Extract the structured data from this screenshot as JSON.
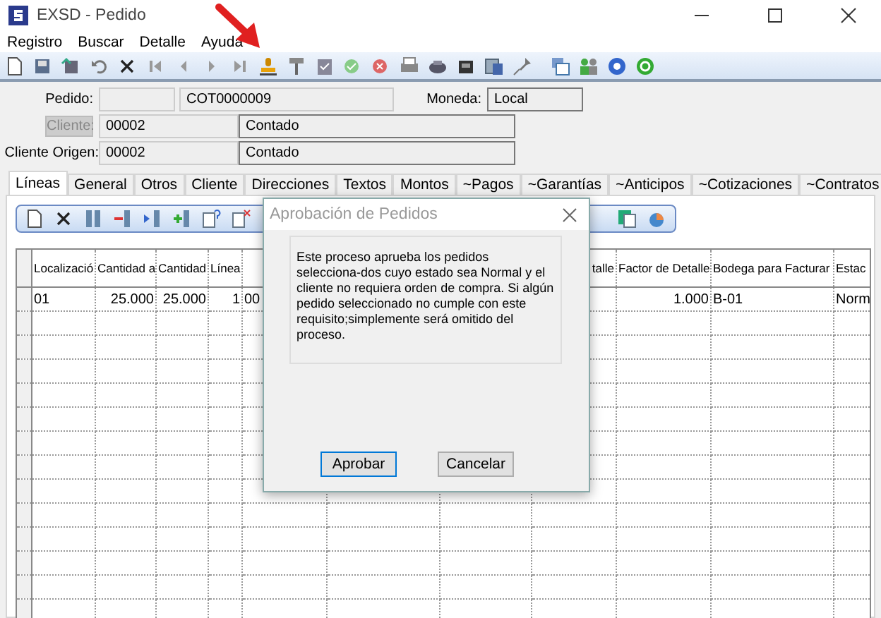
{
  "window": {
    "title": "EXSD - Pedido"
  },
  "menu": [
    "Registro",
    "Buscar",
    "Detalle",
    "Ayuda"
  ],
  "header": {
    "pedido_label": "Pedido:",
    "pedido_value": "COT0000009",
    "moneda_label": "Moneda:",
    "moneda_value": "Local",
    "cliente_button": {
      "label": "Cliente:",
      "disabled": true
    },
    "cliente_code": "00002",
    "cliente_name": "Contado",
    "origen_label": "Cliente Origen:",
    "origen_code": "00002",
    "origen_name": "Contado"
  },
  "tabs": [
    {
      "label": "Líneas",
      "selected": true
    },
    {
      "label": "General",
      "selected": false
    },
    {
      "label": "Otros",
      "selected": false
    },
    {
      "label": "Cliente",
      "selected": false
    },
    {
      "label": "Direcciones",
      "selected": false
    },
    {
      "label": "Textos",
      "selected": false
    },
    {
      "label": "Montos",
      "selected": false
    },
    {
      "label": "~Pagos",
      "selected": false
    },
    {
      "label": "~Garantías",
      "selected": false
    },
    {
      "label": "~Anticipos",
      "selected": false
    },
    {
      "label": "~Cotizaciones",
      "selected": false
    },
    {
      "label": "~Contratos",
      "selected": false
    }
  ],
  "grid": {
    "columns": [
      {
        "label": "Localizació"
      },
      {
        "label": "Cantidad a"
      },
      {
        "label": "Cantidad"
      },
      {
        "label": "Línea"
      },
      {},
      {},
      {},
      {
        "label": "talle"
      },
      {
        "label": "Factor de Detalle"
      },
      {
        "label": "Bodega para Facturar"
      },
      {
        "label": "Estac"
      }
    ],
    "rows": [
      {
        "cells": [
          "01",
          "25.000",
          "25.000",
          "1",
          "00",
          null,
          null,
          null,
          "1.000",
          "B-01",
          "Norm"
        ]
      }
    ]
  },
  "dialog": {
    "title": "Aprobación de Pedidos",
    "message": "Este proceso aprueba los pedidos selecciona-dos cuyo estado sea Normal y el cliente no requiera orden de compra. Si algún pedido seleccionado no cumple con este requisito;simplemente será omitido del proceso.",
    "buttons": [
      {
        "label": "Aprobar",
        "selected": true
      },
      {
        "label": "Cancelar",
        "selected": false
      }
    ]
  }
}
